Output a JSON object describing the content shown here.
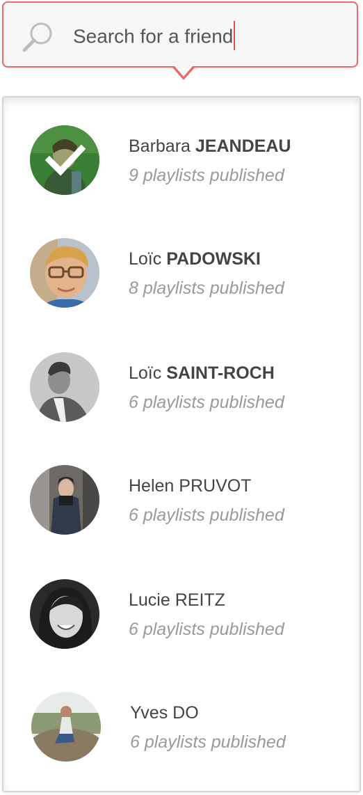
{
  "search": {
    "typed_text": "Search for a friend",
    "icon": "search-icon",
    "accent_color": "#e86a6a",
    "caret_color": "#e0504f"
  },
  "friends": [
    {
      "first": "Barbara",
      "last": "JEANDEAU",
      "count_text": "9 playlists published",
      "selected": true,
      "avatar": "photo-green"
    },
    {
      "first": "Loïc",
      "last": "PADOWSKI",
      "count_text": "8 playlists published",
      "selected": false,
      "avatar": "photo-boy-glasses"
    },
    {
      "first": "Loïc",
      "last": "SAINT-ROCH",
      "count_text": "6 playlists published",
      "selected": false,
      "avatar": "photo-grayscale-man"
    },
    {
      "first": "Helen",
      "last": "PRUVOT",
      "count_text": "6 playlists published",
      "selected": false,
      "avatar": "photo-street-woman"
    },
    {
      "first": "Lucie",
      "last": "REITZ",
      "count_text": "6 playlists published",
      "selected": false,
      "avatar": "photo-bw-smiling-woman"
    },
    {
      "first": "Yves",
      "last": "DO",
      "count_text": "6 playlists published",
      "selected": false,
      "avatar": "photo-rock-outdoor"
    }
  ]
}
